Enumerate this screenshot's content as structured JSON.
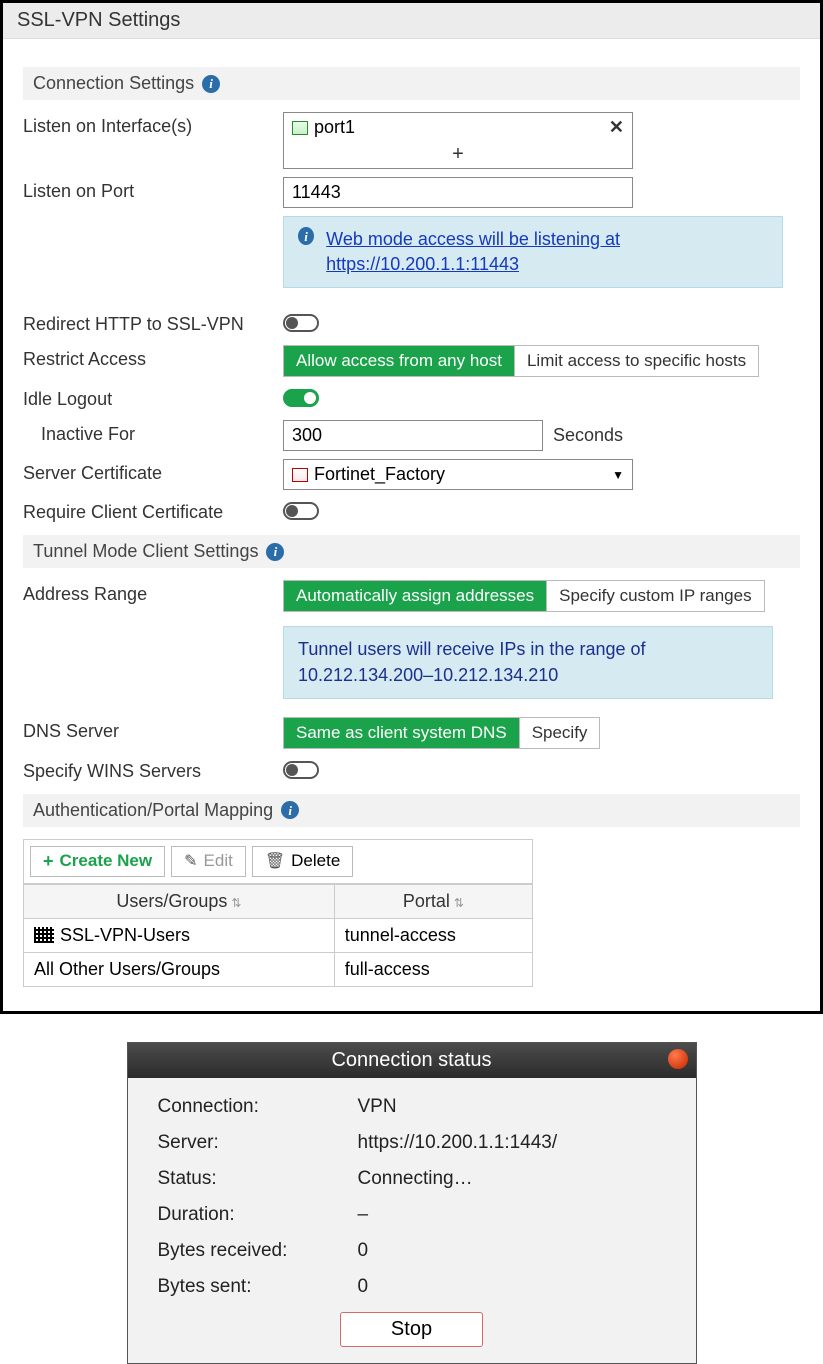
{
  "panel": {
    "title": "SSL-VPN Settings"
  },
  "sections": {
    "connection": "Connection Settings",
    "tunnel": "Tunnel Mode Client Settings",
    "auth": "Authentication/Portal Mapping"
  },
  "labels": {
    "listen_iface": "Listen on Interface(s)",
    "listen_port": "Listen on Port",
    "redirect_http": "Redirect HTTP to SSL-VPN",
    "restrict_access": "Restrict Access",
    "idle_logout": "Idle Logout",
    "inactive_for": "Inactive For",
    "seconds": "Seconds",
    "server_cert": "Server Certificate",
    "require_client_cert": "Require Client Certificate",
    "address_range": "Address Range",
    "dns_server": "DNS Server",
    "specify_wins": "Specify WINS Servers"
  },
  "values": {
    "interface": "port1",
    "port": "11443",
    "inactive_seconds": "300",
    "server_cert": "Fortinet_Factory"
  },
  "banner": {
    "web_mode_prefix": "Web mode access will be listening at ",
    "web_mode_url": "https://10.200.1.1:11443",
    "tunnel_range": "Tunnel users will receive IPs in the range of 10.212.134.200–10.212.134.210"
  },
  "seg": {
    "restrict_any": "Allow access from any host",
    "restrict_limit": "Limit access to specific hosts",
    "addr_auto": "Automatically assign addresses",
    "addr_custom": "Specify custom IP ranges",
    "dns_same": "Same as client system DNS",
    "dns_specify": "Specify"
  },
  "toolbar": {
    "create": "Create New",
    "edit": "Edit",
    "delete": "Delete"
  },
  "table": {
    "col_users": "Users/Groups",
    "col_portal": "Portal",
    "rows": [
      {
        "users": "SSL-VPN-Users",
        "portal": "tunnel-access",
        "has_icon": true
      },
      {
        "users": "All Other Users/Groups",
        "portal": "full-access",
        "has_icon": false
      }
    ]
  },
  "conn": {
    "title": "Connection status",
    "rows": {
      "connection_k": "Connection:",
      "connection_v": "VPN",
      "server_k": "Server:",
      "server_v": "https://10.200.1.1:1443/",
      "status_k": "Status:",
      "status_v": "Connecting…",
      "duration_k": "Duration:",
      "duration_v": "–",
      "bytes_rx_k": "Bytes received:",
      "bytes_rx_v": "0",
      "bytes_tx_k": "Bytes sent:",
      "bytes_tx_v": "0"
    },
    "stop": "Stop"
  }
}
